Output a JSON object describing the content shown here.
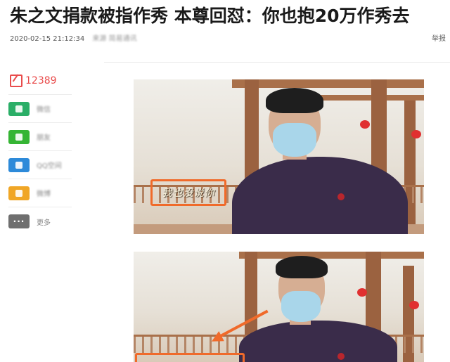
{
  "article": {
    "title": "朱之文捐款被指作秀 本尊回怼：你也抱20万作秀去",
    "timestamp": "2020-02-15 21:12:34",
    "source": "来源 简易通讯",
    "report_label": "举报"
  },
  "sidebar": {
    "comment_count": "12389",
    "share_items": [
      {
        "label": "微信",
        "icon": "wechat-icon",
        "color": "#2aae67",
        "blurred": true
      },
      {
        "label": "朋友",
        "icon": "moments-icon",
        "color": "#35b534",
        "blurred": true
      },
      {
        "label": "QQ空间",
        "icon": "qzone-icon",
        "color": "#2d8ad9",
        "blurred": true
      },
      {
        "label": "微博",
        "icon": "weibo-icon",
        "color": "#f0a626",
        "blurred": true
      },
      {
        "label": "更多",
        "icon": "more-icon",
        "color": "#6f6f6f",
        "blurred": false
      }
    ]
  },
  "images": [
    {
      "subtitle": "我也没说你"
    },
    {
      "subtitle": ""
    }
  ],
  "colors": {
    "highlight": "#f06a2a",
    "comment_red": "#e94c4c"
  }
}
